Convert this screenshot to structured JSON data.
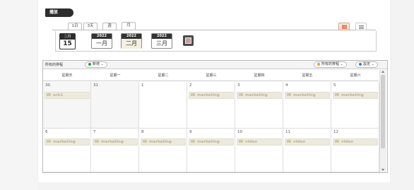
{
  "header": {
    "tag_label": "播放"
  },
  "view_tabs": [
    {
      "label": "1日"
    },
    {
      "label": "3天"
    },
    {
      "label": "週"
    },
    {
      "label": "月"
    }
  ],
  "today": {
    "month": "二月",
    "day": "15"
  },
  "months": [
    {
      "year": "2022",
      "month": "一月"
    },
    {
      "year": "2022",
      "month": "二月"
    },
    {
      "year": "2022",
      "month": "三月"
    }
  ],
  "calendar": {
    "title": "所有的排程",
    "new_label": "新增",
    "all_calendars_label": "所有的排程",
    "settings_label": "設定",
    "accent_color": "#2a9a3a",
    "weekdays": [
      "星期天",
      "星期一",
      "星期二",
      "星期三",
      "星期四",
      "星期五",
      "星期六"
    ],
    "weeks": [
      [
        {
          "day": "30",
          "event": "sch1"
        },
        {
          "day": "31",
          "event": ""
        },
        {
          "day": "1",
          "event": ""
        },
        {
          "day": "2",
          "event": "marketing"
        },
        {
          "day": "3",
          "event": "marketing"
        },
        {
          "day": "4",
          "event": "marketing"
        },
        {
          "day": "5",
          "event": "marketing"
        }
      ],
      [
        {
          "day": "6",
          "event": "marketing"
        },
        {
          "day": "7",
          "event": "marketing"
        },
        {
          "day": "8",
          "event": "marketing"
        },
        {
          "day": "9",
          "event": "marketing"
        },
        {
          "day": "10",
          "event": "video"
        },
        {
          "day": "11",
          "event": "video"
        },
        {
          "day": "12",
          "event": "video"
        }
      ]
    ]
  }
}
